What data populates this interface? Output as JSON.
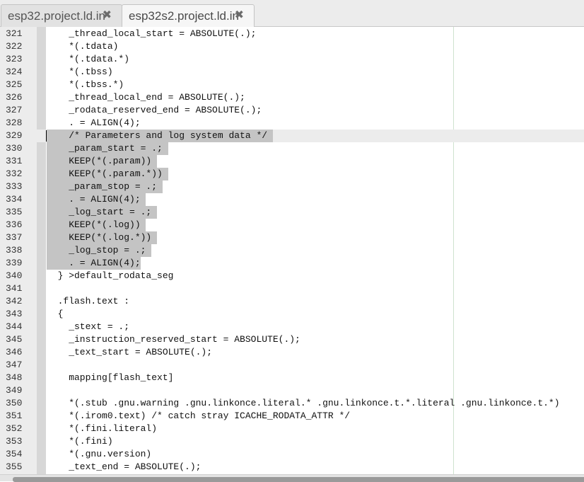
{
  "tabs": [
    {
      "label": "esp32.project.ld.in",
      "close": "✖"
    },
    {
      "label": "esp32s2.project.ld.in",
      "close": "✖"
    }
  ],
  "editor": {
    "current_line": "329",
    "selection": {
      "from_line": "329",
      "to_line": "339"
    },
    "lines": [
      {
        "num": "321",
        "text": "    _thread_local_start = ABSOLUTE(.);"
      },
      {
        "num": "322",
        "text": "    *(.tdata)"
      },
      {
        "num": "323",
        "text": "    *(.tdata.*)"
      },
      {
        "num": "324",
        "text": "    *(.tbss)"
      },
      {
        "num": "325",
        "text": "    *(.tbss.*)"
      },
      {
        "num": "326",
        "text": "    _thread_local_end = ABSOLUTE(.);"
      },
      {
        "num": "327",
        "text": "    _rodata_reserved_end = ABSOLUTE(.);"
      },
      {
        "num": "328",
        "text": "    . = ALIGN(4);"
      },
      {
        "num": "329",
        "text": "    /* Parameters and log system data */ "
      },
      {
        "num": "330",
        "text": "    _param_start = .; "
      },
      {
        "num": "331",
        "text": "    KEEP(*(.param)) "
      },
      {
        "num": "332",
        "text": "    KEEP(*(.param.*)) "
      },
      {
        "num": "333",
        "text": "    _param_stop = .; "
      },
      {
        "num": "334",
        "text": "    . = ALIGN(4); "
      },
      {
        "num": "335",
        "text": "    _log_start = .; "
      },
      {
        "num": "336",
        "text": "    KEEP(*(.log)) "
      },
      {
        "num": "337",
        "text": "    KEEP(*(.log.*)) "
      },
      {
        "num": "338",
        "text": "    _log_stop = .; "
      },
      {
        "num": "339",
        "text": "    . = ALIGN(4);"
      },
      {
        "num": "340",
        "text": "  } >default_rodata_seg"
      },
      {
        "num": "341",
        "text": ""
      },
      {
        "num": "342",
        "text": "  .flash.text :"
      },
      {
        "num": "343",
        "text": "  {"
      },
      {
        "num": "344",
        "text": "    _stext = .;"
      },
      {
        "num": "345",
        "text": "    _instruction_reserved_start = ABSOLUTE(.);"
      },
      {
        "num": "346",
        "text": "    _text_start = ABSOLUTE(.);"
      },
      {
        "num": "347",
        "text": ""
      },
      {
        "num": "348",
        "text": "    mapping[flash_text]"
      },
      {
        "num": "349",
        "text": ""
      },
      {
        "num": "350",
        "text": "    *(.stub .gnu.warning .gnu.linkonce.literal.* .gnu.linkonce.t.*.literal .gnu.linkonce.t.*)"
      },
      {
        "num": "351",
        "text": "    *(.irom0.text) /* catch stray ICACHE_RODATA_ATTR */"
      },
      {
        "num": "352",
        "text": "    *(.fini.literal)"
      },
      {
        "num": "353",
        "text": "    *(.fini)"
      },
      {
        "num": "354",
        "text": "    *(.gnu.version)"
      },
      {
        "num": "355",
        "text": "    _text_end = ABSOLUTE(.);"
      }
    ]
  }
}
